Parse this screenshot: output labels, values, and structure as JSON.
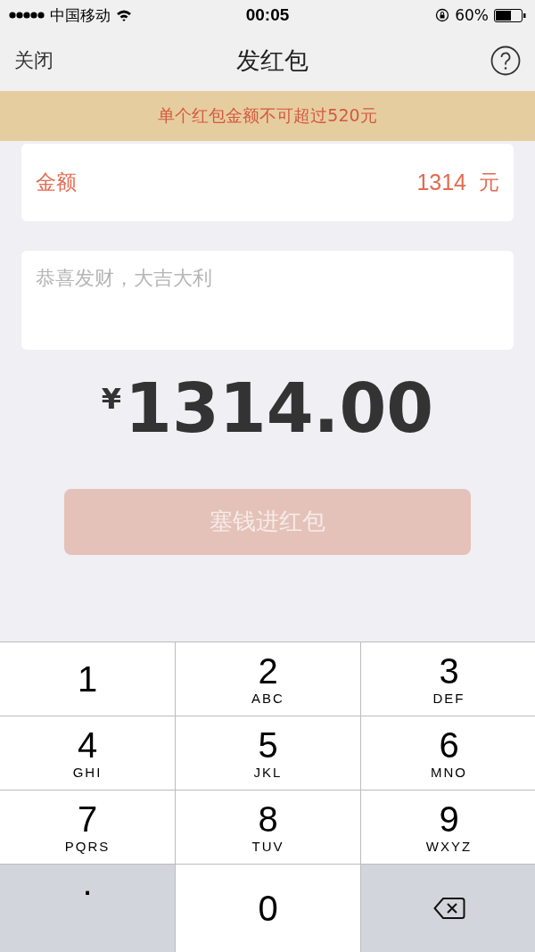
{
  "status_bar": {
    "carrier": "中国移动",
    "time": "00:05",
    "battery": "60%"
  },
  "nav": {
    "close": "关闭",
    "title": "发红包"
  },
  "notice": "单个红包金额不可超过520元",
  "amount_field": {
    "label": "金额",
    "value": "1314",
    "unit": "元"
  },
  "message_field": {
    "placeholder": "恭喜发财，大吉大利"
  },
  "total": {
    "currency": "¥",
    "amount": "1314.00"
  },
  "submit": {
    "label": "塞钱进红包",
    "disabled": true
  },
  "keypad": [
    {
      "kind": "digit",
      "digit": "1"
    },
    {
      "kind": "digit",
      "digit": "2",
      "letters": "ABC"
    },
    {
      "kind": "digit",
      "digit": "3",
      "letters": "DEF"
    },
    {
      "kind": "digit",
      "digit": "4",
      "letters": "GHI"
    },
    {
      "kind": "digit",
      "digit": "5",
      "letters": "JKL"
    },
    {
      "kind": "digit",
      "digit": "6",
      "letters": "MNO"
    },
    {
      "kind": "digit",
      "digit": "7",
      "letters": "PQRS"
    },
    {
      "kind": "digit",
      "digit": "8",
      "letters": "TUV"
    },
    {
      "kind": "digit",
      "digit": "9",
      "letters": "WXYZ"
    },
    {
      "kind": "symbol",
      "digit": "."
    },
    {
      "kind": "digit",
      "digit": "0"
    },
    {
      "kind": "delete"
    }
  ]
}
